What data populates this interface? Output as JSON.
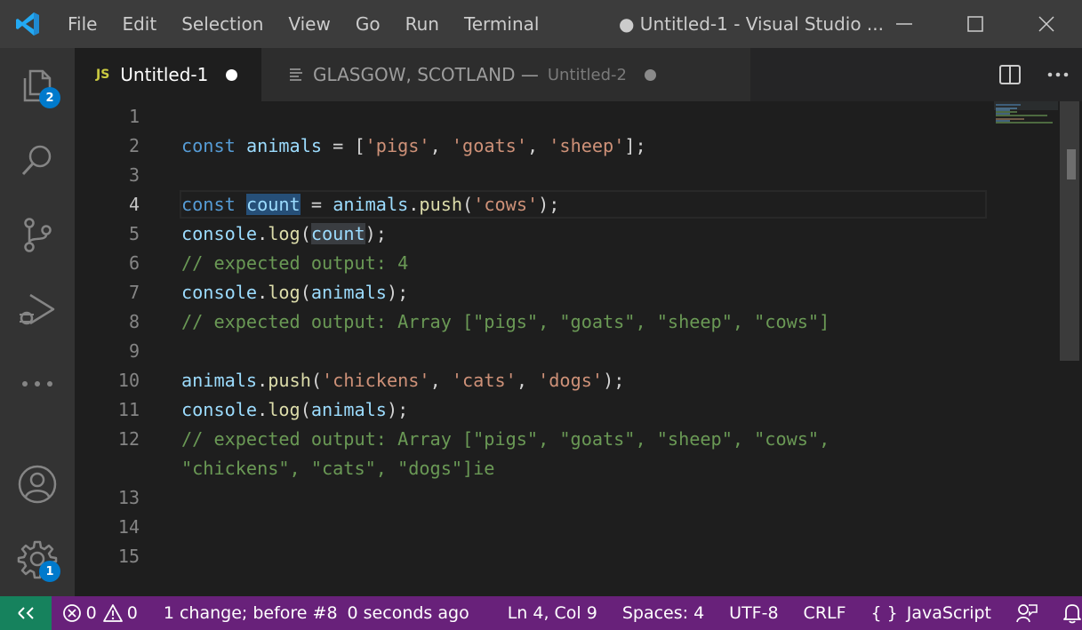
{
  "menu": [
    "File",
    "Edit",
    "Selection",
    "View",
    "Go",
    "Run",
    "Terminal"
  ],
  "window_title": "● Untitled-1 - Visual Studio ...",
  "activity": {
    "explorer_badge": "2",
    "manage_badge": "1",
    "icons": [
      "files-icon",
      "search-icon",
      "source-control-icon",
      "run-debug-icon",
      "more-icon",
      "accounts-icon",
      "manage-gear-icon"
    ]
  },
  "tabs": [
    {
      "icon_text": "JS",
      "label": "Untitled-1",
      "dirty": true,
      "active": true
    },
    {
      "label": "GLASGOW, SCOTLAND —",
      "description": "Untitled-2",
      "dirty": true,
      "active": false
    }
  ],
  "editor": {
    "current_line": 4,
    "line_numbers": [
      "1",
      "2",
      "3",
      "4",
      "5",
      "6",
      "7",
      "8",
      "9",
      "10",
      "11",
      "12",
      "13",
      "14",
      "15"
    ]
  },
  "status": {
    "errors": "0",
    "warnings": "0",
    "timeline": "1 change; before #8",
    "time_ago": "0 seconds ago",
    "position": "Ln 4, Col 9",
    "spaces": "Spaces: 4",
    "encoding": "UTF-8",
    "eol": "CRLF",
    "language_icon": "{ }",
    "language": "JavaScript"
  },
  "colors": {
    "titlebar": "#3c3c3c",
    "activitybar": "#333333",
    "editor_bg": "#1e1e1e",
    "statusbar": "#68217a",
    "remote": "#16825d",
    "badge": "#007acc"
  }
}
